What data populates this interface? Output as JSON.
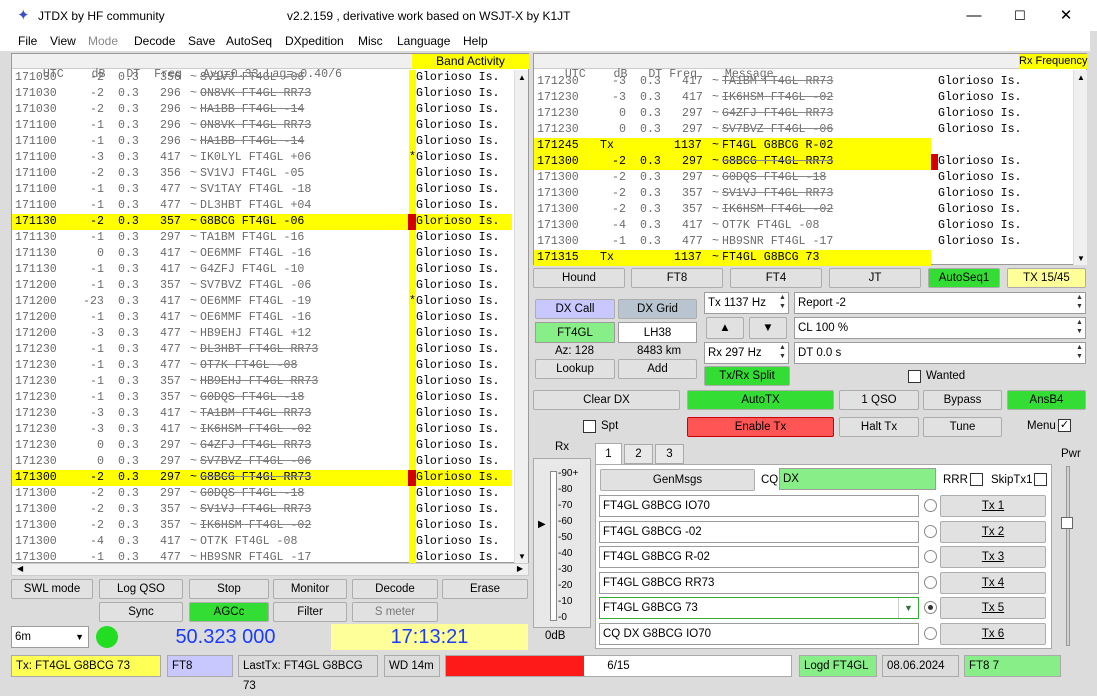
{
  "window": {
    "title": "JTDX  by HF community",
    "subtitle": "v2.2.159 , derivative work based on WSJT-X by K1JT",
    "minimize": "—",
    "maximize": "☐",
    "close": "✕"
  },
  "menu": [
    "File",
    "View",
    "Mode",
    "Decode",
    "Save",
    "AutoSeq",
    "DXpedition",
    "Misc",
    "Language",
    "Help"
  ],
  "left": {
    "header": "UTC    dB   DT  Freq   Avg=0.33 Lag=-0.40/6",
    "band_activity": "Band Activity",
    "rows": [
      {
        "utc": "171030",
        "db": "-2",
        "dt": "0.3",
        "freq": "356",
        "msg": "SV1VJ FT4GL -06",
        "country": "Glorioso Is.",
        "s": 1
      },
      {
        "utc": "171030",
        "db": "-2",
        "dt": "0.3",
        "freq": "296",
        "msg": "ON8VK FT4GL RR73",
        "country": "Glorioso Is.",
        "s": 1
      },
      {
        "utc": "171030",
        "db": "-2",
        "dt": "0.3",
        "freq": "296",
        "msg": "HA1BB FT4GL -14",
        "country": "Glorioso Is.",
        "s": 1
      },
      {
        "utc": "171100",
        "db": "-1",
        "dt": "0.3",
        "freq": "296",
        "msg": "ON8VK FT4GL RR73",
        "country": "Glorioso Is.",
        "s": 1
      },
      {
        "utc": "171100",
        "db": "-1",
        "dt": "0.3",
        "freq": "296",
        "msg": "HA1BB FT4GL -14",
        "country": "Glorioso Is.",
        "s": 1
      },
      {
        "utc": "171100",
        "db": "-3",
        "dt": "0.3",
        "freq": "417",
        "msg": "IK0LYL FT4GL +06",
        "country": "Glorioso Is.",
        "star": "*"
      },
      {
        "utc": "171100",
        "db": "-2",
        "dt": "0.3",
        "freq": "356",
        "msg": "SV1VJ FT4GL -05",
        "country": "Glorioso Is."
      },
      {
        "utc": "171100",
        "db": "-1",
        "dt": "0.3",
        "freq": "477",
        "msg": "SV1TAY FT4GL -18",
        "country": "Glorioso Is."
      },
      {
        "utc": "171100",
        "db": "-1",
        "dt": "0.3",
        "freq": "477",
        "msg": "DL3HBT FT4GL +04",
        "country": "Glorioso Is."
      },
      {
        "utc": "171130",
        "db": "-2",
        "dt": "0.3",
        "freq": "357",
        "msg": "G8BCG FT4GL -06",
        "country": "Glorioso Is.",
        "hl": 1
      },
      {
        "utc": "171130",
        "db": "-1",
        "dt": "0.3",
        "freq": "297",
        "msg": "TA1BM FT4GL -16",
        "country": "Glorioso Is."
      },
      {
        "utc": "171130",
        "db": "0",
        "dt": "0.3",
        "freq": "417",
        "msg": "OE6MMF FT4GL -16",
        "country": "Glorioso Is."
      },
      {
        "utc": "171130",
        "db": "-1",
        "dt": "0.3",
        "freq": "417",
        "msg": "G4ZFJ FT4GL -10",
        "country": "Glorioso Is."
      },
      {
        "utc": "171200",
        "db": "-1",
        "dt": "0.3",
        "freq": "357",
        "msg": "SV7BVZ FT4GL -06",
        "country": "Glorioso Is."
      },
      {
        "utc": "171200",
        "db": "-23",
        "dt": "0.3",
        "freq": "417",
        "msg": "OE6MMF FT4GL -19",
        "country": "Glorioso Is.",
        "star": "*"
      },
      {
        "utc": "171200",
        "db": "-1",
        "dt": "0.3",
        "freq": "417",
        "msg": "OE6MMF FT4GL -16",
        "country": "Glorioso Is."
      },
      {
        "utc": "171200",
        "db": "-3",
        "dt": "0.3",
        "freq": "477",
        "msg": "HB9EHJ FT4GL +12",
        "country": "Glorioso Is."
      },
      {
        "utc": "171230",
        "db": "-1",
        "dt": "0.3",
        "freq": "477",
        "msg": "DL3HBT FT4GL RR73",
        "country": "Glorioso Is.",
        "s": 1
      },
      {
        "utc": "171230",
        "db": "-1",
        "dt": "0.3",
        "freq": "477",
        "msg": "OT7K FT4GL -08",
        "country": "Glorioso Is.",
        "s": 1
      },
      {
        "utc": "171230",
        "db": "-1",
        "dt": "0.3",
        "freq": "357",
        "msg": "HB9EHJ FT4GL RR73",
        "country": "Glorioso Is.",
        "s": 1
      },
      {
        "utc": "171230",
        "db": "-1",
        "dt": "0.3",
        "freq": "357",
        "msg": "G0DQS FT4GL -18",
        "country": "Glorioso Is.",
        "s": 1
      },
      {
        "utc": "171230",
        "db": "-3",
        "dt": "0.3",
        "freq": "417",
        "msg": "TA1BM FT4GL RR73",
        "country": "Glorioso Is.",
        "s": 1
      },
      {
        "utc": "171230",
        "db": "-3",
        "dt": "0.3",
        "freq": "417",
        "msg": "IK6HSM FT4GL -02",
        "country": "Glorioso Is.",
        "s": 1
      },
      {
        "utc": "171230",
        "db": "0",
        "dt": "0.3",
        "freq": "297",
        "msg": "G4ZFJ FT4GL RR73",
        "country": "Glorioso Is.",
        "s": 1
      },
      {
        "utc": "171230",
        "db": "0",
        "dt": "0.3",
        "freq": "297",
        "msg": "SV7BVZ FT4GL -06",
        "country": "Glorioso Is.",
        "s": 1
      },
      {
        "utc": "171300",
        "db": "-2",
        "dt": "0.3",
        "freq": "297",
        "msg": "G8BCG FT4GL RR73",
        "country": "Glorioso Is.",
        "hl": 1,
        "s": 1
      },
      {
        "utc": "171300",
        "db": "-2",
        "dt": "0.3",
        "freq": "297",
        "msg": "G0DQS FT4GL -18",
        "country": "Glorioso Is.",
        "s": 1
      },
      {
        "utc": "171300",
        "db": "-2",
        "dt": "0.3",
        "freq": "357",
        "msg": "SV1VJ FT4GL RR73",
        "country": "Glorioso Is.",
        "s": 1
      },
      {
        "utc": "171300",
        "db": "-2",
        "dt": "0.3",
        "freq": "357",
        "msg": "IK6HSM FT4GL -02",
        "country": "Glorioso Is.",
        "s": 1
      },
      {
        "utc": "171300",
        "db": "-4",
        "dt": "0.3",
        "freq": "417",
        "msg": "OT7K FT4GL -08",
        "country": "Glorioso Is."
      },
      {
        "utc": "171300",
        "db": "-1",
        "dt": "0.3",
        "freq": "477",
        "msg": "HB9SNR FT4GL -17",
        "country": "Glorioso Is."
      }
    ]
  },
  "right": {
    "header": "UTC    dB   DT Freq    Message",
    "rx_frequency": "Rx Frequency",
    "rows": [
      {
        "utc": "171230",
        "db": "-3",
        "dt": "0.3",
        "freq": "417",
        "msg": "TA1BM FT4GL RR73",
        "country": "Glorioso Is.",
        "s": 1
      },
      {
        "utc": "171230",
        "db": "-3",
        "dt": "0.3",
        "freq": "417",
        "msg": "IK6HSM FT4GL -02",
        "country": "Glorioso Is.",
        "s": 1
      },
      {
        "utc": "171230",
        "db": "0",
        "dt": "0.3",
        "freq": "297",
        "msg": "G4ZFJ FT4GL RR73",
        "country": "Glorioso Is.",
        "s": 1
      },
      {
        "utc": "171230",
        "db": "0",
        "dt": "0.3",
        "freq": "297",
        "msg": "SV7BVZ FT4GL -06",
        "country": "Glorioso Is.",
        "s": 1
      },
      {
        "utc": "171245",
        "tx": "Tx",
        "freq": "1137",
        "msg": "FT4GL G8BCG R-02",
        "hl": 1
      },
      {
        "utc": "171300",
        "db": "-2",
        "dt": "0.3",
        "freq": "297",
        "msg": "G8BCG FT4GL RR73",
        "country": "Glorioso Is.",
        "hl": 1,
        "s": 1,
        "red": 1
      },
      {
        "utc": "171300",
        "db": "-2",
        "dt": "0.3",
        "freq": "297",
        "msg": "G0DQS FT4GL -18",
        "country": "Glorioso Is.",
        "s": 1
      },
      {
        "utc": "171300",
        "db": "-2",
        "dt": "0.3",
        "freq": "357",
        "msg": "SV1VJ FT4GL RR73",
        "country": "Glorioso Is.",
        "s": 1
      },
      {
        "utc": "171300",
        "db": "-2",
        "dt": "0.3",
        "freq": "357",
        "msg": "IK6HSM FT4GL -02",
        "country": "Glorioso Is.",
        "s": 1
      },
      {
        "utc": "171300",
        "db": "-4",
        "dt": "0.3",
        "freq": "417",
        "msg": "OT7K FT4GL -08",
        "country": "Glorioso Is."
      },
      {
        "utc": "171300",
        "db": "-1",
        "dt": "0.3",
        "freq": "477",
        "msg": "HB9SNR FT4GL -17",
        "country": "Glorioso Is."
      },
      {
        "utc": "171315",
        "tx": "Tx",
        "freq": "1137",
        "msg": "FT4GL G8BCG 73",
        "hl": 1
      }
    ]
  },
  "modebar": {
    "hound": "Hound",
    "ft8": "FT8",
    "ft4": "FT4",
    "jt": "JT",
    "autoseq1": "AutoSeq1",
    "tx1545": "TX 15/45"
  },
  "dx": {
    "dxcall_label": "DX Call",
    "dxgrid_label": "DX Grid",
    "call": "FT4GL",
    "grid": "LH38",
    "az": "Az: 128",
    "dist": "8483 km",
    "lookup": "Lookup",
    "add": "Add",
    "txrx_split": "Tx/Rx Split"
  },
  "freqs": {
    "tx": "Tx  1137 Hz",
    "report": "Report -2",
    "up": "▲",
    "down": "▼",
    "cl": "CL  100 %",
    "rx": "Rx  297 Hz",
    "dt": "DT 0.0 s",
    "wanted": "Wanted"
  },
  "controls": {
    "clear_dx": "Clear DX",
    "autotx": "AutoTX",
    "one_qso": "1 QSO",
    "bypass": "Bypass",
    "ansb4": "AnsB4",
    "spt": "Spt",
    "enable_tx": "Enable Tx",
    "halt_tx": "Halt Tx",
    "tune": "Tune",
    "menu": "Menu"
  },
  "bottom": {
    "swl": "SWL mode",
    "logqso": "Log QSO",
    "stop": "Stop",
    "monitor": "Monitor",
    "decode": "Decode",
    "erase": "Erase",
    "sync": "Sync",
    "agcc": "AGCc",
    "filter": "Filter",
    "smeter": "S meter",
    "band": "6m",
    "frequency": "50.323 000",
    "time": "17:13:21"
  },
  "rx": {
    "label": "Rx",
    "scale": [
      "90+",
      "80",
      "70",
      "60",
      "50",
      "40",
      "30",
      "20",
      "10",
      "0"
    ],
    "db": "0dB",
    "pwr": "Pwr"
  },
  "tabs": [
    "1",
    "2",
    "3"
  ],
  "msgs": {
    "genmsgs": "GenMsgs",
    "cq": "CQ",
    "cq_value": "DX",
    "rrr": "RRR",
    "skiptx1": "SkipTx1",
    "items": [
      {
        "text": "FT4GL G8BCG IO70",
        "btn": "Tx 1"
      },
      {
        "text": "FT4GL G8BCG -02",
        "btn": "Tx 2"
      },
      {
        "text": "FT4GL G8BCG R-02",
        "btn": "Tx 3"
      },
      {
        "text": "FT4GL G8BCG RR73",
        "btn": "Tx 4"
      },
      {
        "text": "FT4GL G8BCG 73",
        "btn": "Tx 5"
      },
      {
        "text": "CQ DX G8BCG IO70",
        "btn": "Tx 6"
      }
    ]
  },
  "statusbar": {
    "tx": "Tx: FT4GL G8BCG 73",
    "mode": "FT8",
    "lasttx": "LastTx: FT4GL G8BCG 73",
    "wd": "WD 14m",
    "progress": "6/15",
    "progress_fraction": 0.4,
    "logd": "Logd FT4GL",
    "date": "08.06.2024",
    "ft8": "FT8  7"
  },
  "colors": {
    "highlight": "#ffff00",
    "green": "#33dd33",
    "red_bar": "#d40000",
    "freq_text": "#1a3cff"
  }
}
